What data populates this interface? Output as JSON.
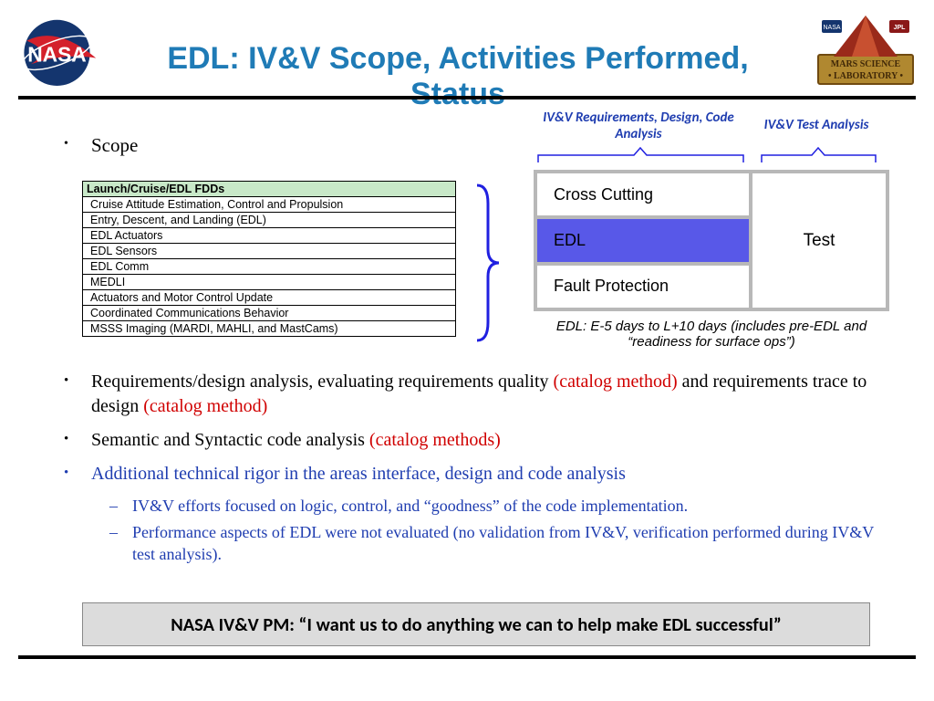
{
  "title": "EDL: IV&V Scope, Activities Performed, Status",
  "scope_label": "Scope",
  "fdd": {
    "header": "Launch/Cruise/EDL FDDs",
    "rows": [
      "Cruise Attitude Estimation, Control and Propulsion",
      "Entry, Descent, and Landing (EDL)",
      "EDL Actuators",
      "EDL Sensors",
      "EDL Comm",
      "MEDLI",
      "Actuators and Motor Control Update",
      "Coordinated Communications Behavior",
      "MSSS Imaging (MARDI, MAHLI, and MastCams)"
    ]
  },
  "diagram": {
    "label_left": "IV&V Requirements, Design, Code Analysis",
    "label_right": "IV&V Test Analysis",
    "cells": [
      "Cross Cutting",
      "EDL",
      "Fault Protection"
    ],
    "right": "Test",
    "caption": "EDL: E-5 days to L+10 days (includes pre-EDL and “readiness for surface ops”)"
  },
  "bullets": {
    "b1_a": "Requirements/design analysis, evaluating requirements quality ",
    "b1_a_red": "(catalog method)",
    "b1_b": " and requirements trace to design ",
    "b1_b_red": "(catalog method)",
    "b2": "Semantic and Syntactic code analysis ",
    "b2_red": "(catalog methods)",
    "b3": "Additional technical rigor in the areas interface, design and code analysis",
    "b3_1": "IV&V efforts focused on logic, control, and “goodness” of the code implementation.",
    "b3_2": "Performance aspects of EDL were not evaluated (no validation from IV&V, verification performed during IV&V test analysis)."
  },
  "quote": "NASA IV&V PM: “I want us to do anything we can to  help make EDL successful”"
}
